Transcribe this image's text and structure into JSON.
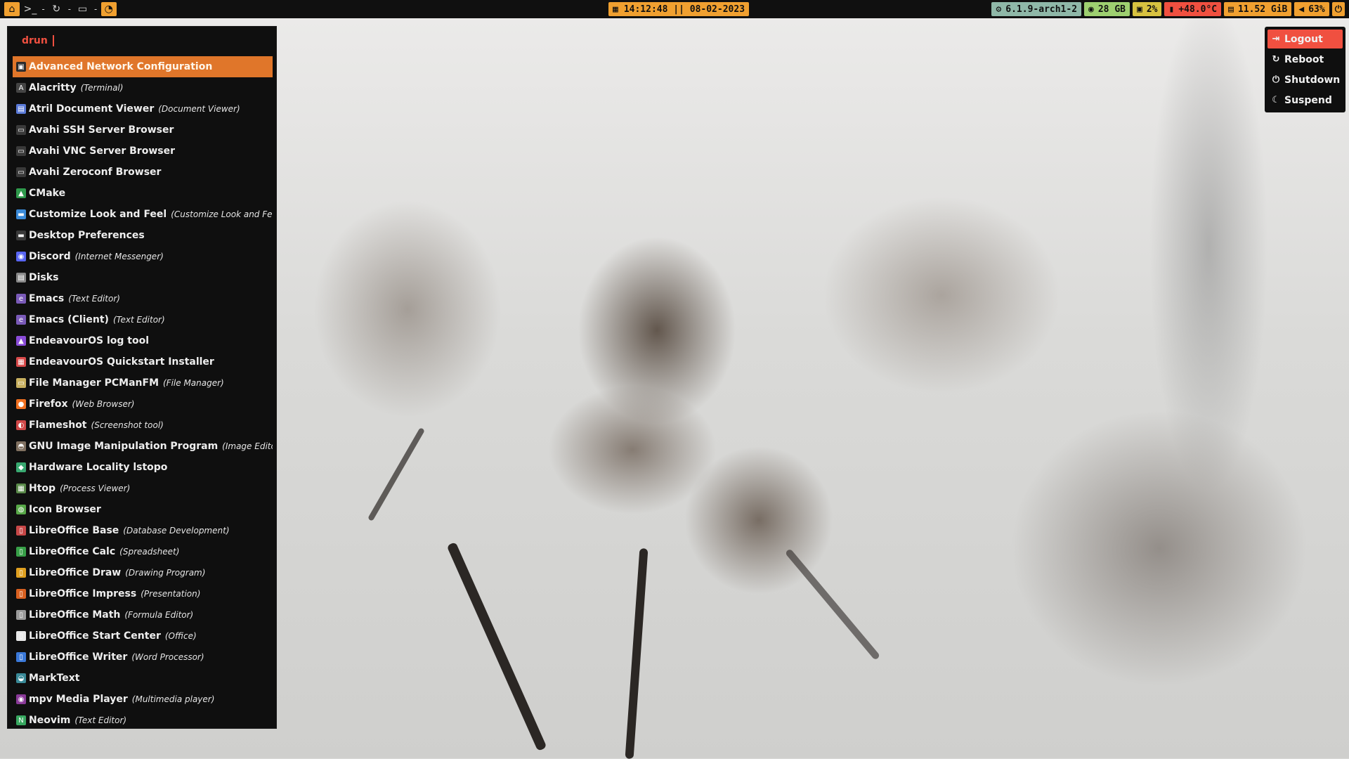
{
  "topbar": {
    "launcher_icons": [
      "home-icon",
      "terminal-icon",
      "refresh-icon",
      "folder-icon",
      "pacman-icon"
    ],
    "separator": "-",
    "clock": "14:12:48 || 08-02-2023",
    "modules": [
      {
        "name": "kernel",
        "icon": "kernel-icon",
        "value": "6.1.9-arch1-2",
        "color": "#8fb8a8"
      },
      {
        "name": "disk",
        "icon": "disk-icon",
        "value": "28 GB",
        "color": "#9ed070"
      },
      {
        "name": "cpu",
        "icon": "cpu-icon",
        "value": "2%",
        "color": "#d8c240"
      },
      {
        "name": "temperature",
        "icon": "thermometer-icon",
        "value": "+48.0°C",
        "color": "#f05040"
      },
      {
        "name": "memory",
        "icon": "memory-icon",
        "value": "11.52 GiB",
        "color": "#f0a030"
      },
      {
        "name": "volume",
        "icon": "volume-icon",
        "value": "63%",
        "color": "#f0a030"
      },
      {
        "name": "power",
        "icon": "power-icon",
        "value": "",
        "color": "#f0a030"
      }
    ]
  },
  "launcher": {
    "prompt": "drun",
    "items": [
      {
        "name": "Advanced Network Configuration",
        "category": "",
        "icon": "network-icon",
        "color": "#2b2b2b",
        "selected": true
      },
      {
        "name": "Alacritty",
        "category": "(Terminal)",
        "icon": "alacritty-icon",
        "color": "#444444"
      },
      {
        "name": "Atril Document Viewer",
        "category": "(Document Viewer)",
        "icon": "document-viewer-icon",
        "color": "#5a7ad8"
      },
      {
        "name": "Avahi SSH Server Browser",
        "category": "",
        "icon": "avahi-icon",
        "color": "#3a3a3a"
      },
      {
        "name": "Avahi VNC Server Browser",
        "category": "",
        "icon": "avahi-icon",
        "color": "#3a3a3a"
      },
      {
        "name": "Avahi Zeroconf Browser",
        "category": "",
        "icon": "avahi-icon",
        "color": "#3a3a3a"
      },
      {
        "name": "CMake",
        "category": "",
        "icon": "cmake-icon",
        "color": "#2f9a4c"
      },
      {
        "name": "Customize Look and Feel",
        "category": "(Customize Look and Feel)",
        "icon": "appearance-icon",
        "color": "#3a8ad8"
      },
      {
        "name": "Desktop Preferences",
        "category": "",
        "icon": "desktop-icon",
        "color": "#3a3a3a"
      },
      {
        "name": "Discord",
        "category": "(Internet Messenger)",
        "icon": "discord-icon",
        "color": "#5865f2"
      },
      {
        "name": "Disks",
        "category": "",
        "icon": "disks-icon",
        "color": "#888888"
      },
      {
        "name": "Emacs",
        "category": "(Text Editor)",
        "icon": "emacs-icon",
        "color": "#7a5ab8"
      },
      {
        "name": "Emacs (Client)",
        "category": "(Text Editor)",
        "icon": "emacs-icon",
        "color": "#7a5ab8"
      },
      {
        "name": "EndeavourOS log tool",
        "category": "",
        "icon": "endeavouros-icon",
        "color": "#8a4cd8"
      },
      {
        "name": "EndeavourOS Quickstart Installer",
        "category": "",
        "icon": "installer-icon",
        "color": "#d84a4a"
      },
      {
        "name": "File Manager PCManFM",
        "category": "(File Manager)",
        "icon": "file-manager-icon",
        "color": "#c8b060"
      },
      {
        "name": "Firefox",
        "category": "(Web Browser)",
        "icon": "firefox-icon",
        "color": "#f07020"
      },
      {
        "name": "Flameshot",
        "category": "(Screenshot tool)",
        "icon": "flameshot-icon",
        "color": "#d04848"
      },
      {
        "name": "GNU Image Manipulation Program",
        "category": "(Image Editor)",
        "icon": "gimp-icon",
        "color": "#807060"
      },
      {
        "name": "Hardware Locality lstopo",
        "category": "",
        "icon": "hwloc-icon",
        "color": "#38a870"
      },
      {
        "name": "Htop",
        "category": "(Process Viewer)",
        "icon": "htop-icon",
        "color": "#5a8a4a"
      },
      {
        "name": "Icon Browser",
        "category": "",
        "icon": "icon-browser-icon",
        "color": "#58a848"
      },
      {
        "name": "LibreOffice Base",
        "category": "(Database Development)",
        "icon": "libreoffice-base-icon",
        "color": "#c84848"
      },
      {
        "name": "LibreOffice Calc",
        "category": "(Spreadsheet)",
        "icon": "libreoffice-calc-icon",
        "color": "#38a048"
      },
      {
        "name": "LibreOffice Draw",
        "category": "(Drawing Program)",
        "icon": "libreoffice-draw-icon",
        "color": "#e0a020"
      },
      {
        "name": "LibreOffice Impress",
        "category": "(Presentation)",
        "icon": "libreoffice-impress-icon",
        "color": "#d86020"
      },
      {
        "name": "LibreOffice Math",
        "category": "(Formula Editor)",
        "icon": "libreoffice-math-icon",
        "color": "#9a9a9a"
      },
      {
        "name": "LibreOffice Start Center",
        "category": "(Office)",
        "icon": "libreoffice-icon",
        "color": "#e8e8e8"
      },
      {
        "name": "LibreOffice Writer",
        "category": "(Word Processor)",
        "icon": "libreoffice-writer-icon",
        "color": "#3a78d8"
      },
      {
        "name": "MarkText",
        "category": "",
        "icon": "marktext-icon",
        "color": "#3a8a98"
      },
      {
        "name": "mpv Media Player",
        "category": "(Multimedia player)",
        "icon": "mpv-icon",
        "color": "#8a3a98"
      },
      {
        "name": "Neovim",
        "category": "(Text Editor)",
        "icon": "neovim-icon",
        "color": "#38a860"
      }
    ]
  },
  "power_menu": {
    "items": [
      {
        "label": "Logout",
        "icon": "logout-icon",
        "selected": true
      },
      {
        "label": "Reboot",
        "icon": "reboot-icon"
      },
      {
        "label": "Shutdown",
        "icon": "shutdown-icon"
      },
      {
        "label": "Suspend",
        "icon": "suspend-icon"
      }
    ]
  },
  "wallpaper": {
    "subject": "wallpaper-image"
  }
}
